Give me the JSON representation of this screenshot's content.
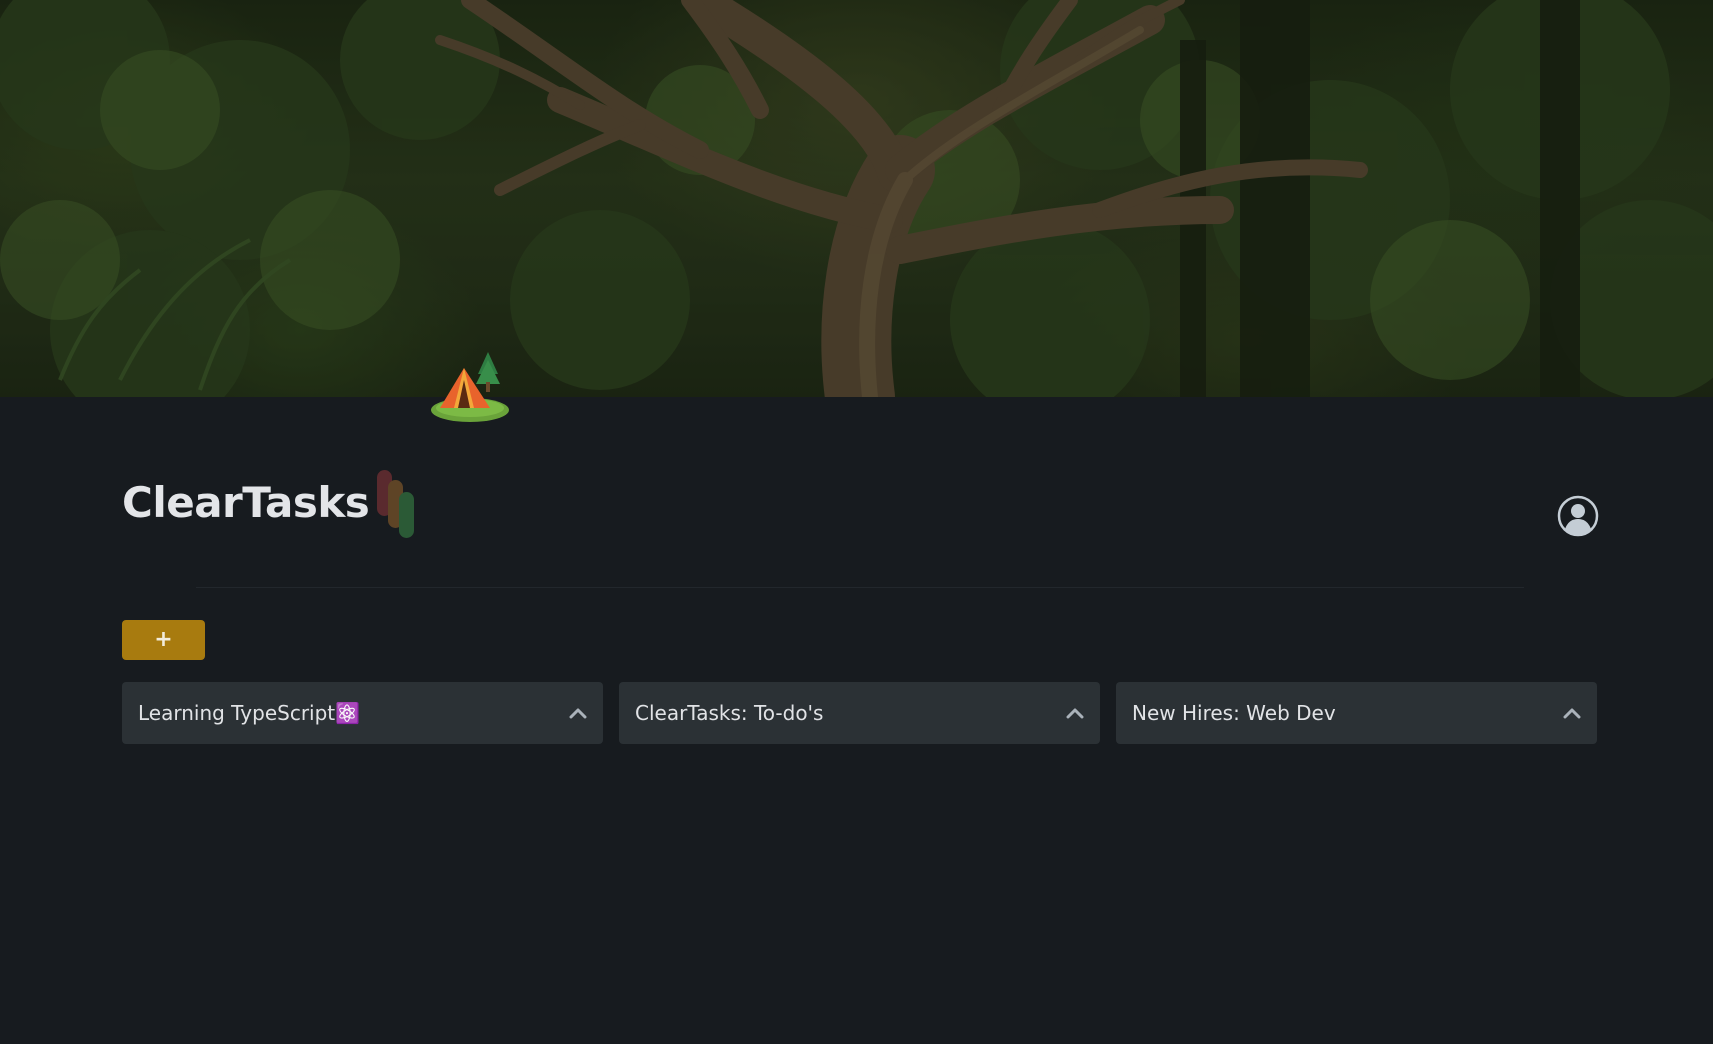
{
  "cover": {
    "description_icon": "forest-cover-image",
    "page_icon": "camping-tent-icon"
  },
  "header": {
    "title": "ClearTasks",
    "logo_icon": "cleartasks-logo-bars-icon",
    "profile_icon": "user-circle-icon"
  },
  "toolbar": {
    "add_label": "+"
  },
  "boards": [
    {
      "title": "Learning TypeScript⚛️",
      "toggle_icon": "chevron-up-icon"
    },
    {
      "title": "ClearTasks: To-do's",
      "toggle_icon": "chevron-up-icon"
    },
    {
      "title": "New Hires: Web Dev",
      "toggle_icon": "chevron-up-icon"
    }
  ],
  "colors": {
    "background": "#171b1f",
    "card": "#2b3135",
    "accent": "#a87b0f",
    "title_text": "#e3e5e8",
    "logo_bar_red": "#5a2a2e",
    "logo_bar_orange": "#5e4426",
    "logo_bar_green": "#2b5a36"
  }
}
